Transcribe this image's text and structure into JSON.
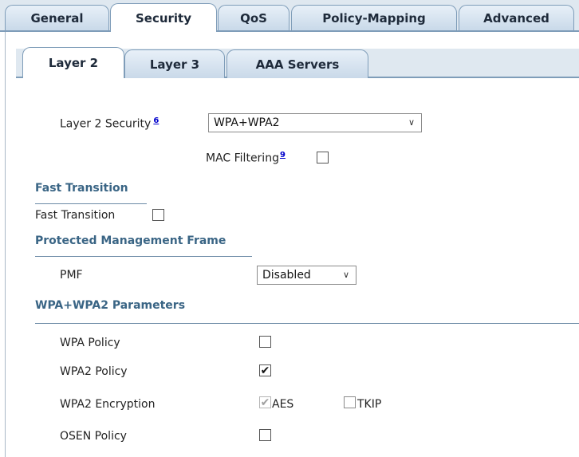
{
  "top_tabs": [
    "General",
    "Security",
    "QoS",
    "Policy-Mapping",
    "Advanced"
  ],
  "top_active": "Security",
  "sub_tabs": [
    "Layer 2",
    "Layer 3",
    "AAA Servers"
  ],
  "sub_active": "Layer 2",
  "layer2": {
    "label": "Layer 2 Security",
    "footnote": "6",
    "value": "WPA+WPA2"
  },
  "mac_filtering": {
    "label": "MAC Filtering",
    "footnote": "9",
    "checked": false
  },
  "fast_transition": {
    "section": "Fast Transition",
    "label": "Fast Transition",
    "checked": false
  },
  "pmf": {
    "section": "Protected Management Frame",
    "label": "PMF",
    "value": "Disabled"
  },
  "wpa_params": {
    "section": "WPA+WPA2 Parameters",
    "wpa_policy": {
      "label": "WPA Policy",
      "checked": false
    },
    "wpa2_policy": {
      "label": "WPA2 Policy",
      "checked": true
    },
    "wpa2_encryption": {
      "label": "WPA2 Encryption",
      "aes": {
        "label": "AES",
        "checked": true,
        "disabled": true
      },
      "tkip": {
        "label": "TKIP",
        "checked": false
      }
    },
    "osen_policy": {
      "label": "OSEN Policy",
      "checked": false
    }
  },
  "colors": {
    "tab_border": "#7f9db9",
    "section_text": "#3a6585",
    "link": "#0000cc"
  }
}
